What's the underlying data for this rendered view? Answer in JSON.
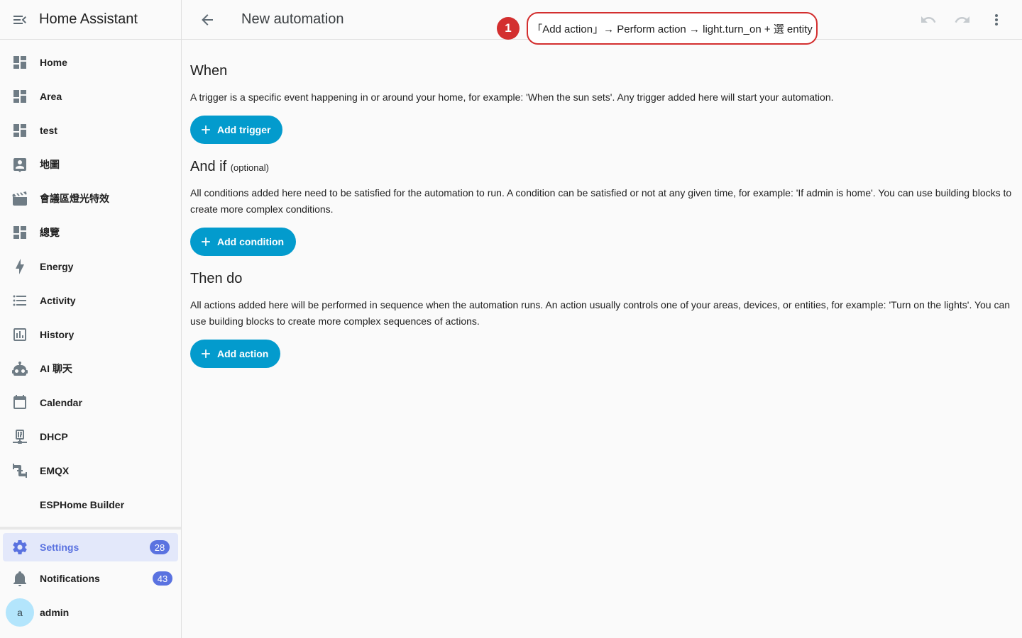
{
  "sidebar": {
    "title": "Home Assistant",
    "items": [
      {
        "label": "Home",
        "icon": "dashboard-icon"
      },
      {
        "label": "Area",
        "icon": "dashboard-icon"
      },
      {
        "label": "test",
        "icon": "dashboard-icon"
      },
      {
        "label": "地圖",
        "icon": "account-box-icon"
      },
      {
        "label": "會議區燈光特效",
        "icon": "movie-open-icon"
      },
      {
        "label": "總覽",
        "icon": "dashboard-icon"
      },
      {
        "label": "Energy",
        "icon": "lightning-icon"
      },
      {
        "label": "Activity",
        "icon": "list-icon"
      },
      {
        "label": "History",
        "icon": "chart-box-icon"
      },
      {
        "label": "AI 聊天",
        "icon": "robot-icon"
      },
      {
        "label": "Calendar",
        "icon": "calendar-icon"
      },
      {
        "label": "DHCP",
        "icon": "ip-network-icon"
      },
      {
        "label": "EMQX",
        "icon": "pipe-icon"
      },
      {
        "label": "ESPHome Builder",
        "icon": "none"
      }
    ],
    "settings": {
      "label": "Settings",
      "badge": "28"
    },
    "notifications": {
      "label": "Notifications",
      "badge": "43"
    },
    "user": {
      "label": "admin",
      "avatar": "a"
    }
  },
  "header": {
    "title": "New automation"
  },
  "callout": {
    "number": "1",
    "text": "「Add action」→ Perform action → light.turn_on + 選 entity"
  },
  "sections": {
    "when": {
      "title": "When",
      "description": "A trigger is a specific event happening in or around your home, for example: 'When the sun sets'. Any trigger added here will start your automation.",
      "button": "Add trigger"
    },
    "andif": {
      "title": "And if",
      "optional": "(optional)",
      "description": "All conditions added here need to be satisfied for the automation to run. A condition can be satisfied or not at any given time, for example: 'If admin is home'. You can use building blocks to create more complex conditions.",
      "button": "Add condition"
    },
    "thendo": {
      "title": "Then do",
      "description": "All actions added here will be performed in sequence when the automation runs. An action usually controls one of your areas, devices, or entities, for example: 'Turn on the lights'. You can use building blocks to create more complex sequences of actions.",
      "button": "Add action"
    }
  },
  "colors": {
    "accent": "#039bcd",
    "sidebar_active": "#5a72e0",
    "callout": "#d32f2f"
  }
}
